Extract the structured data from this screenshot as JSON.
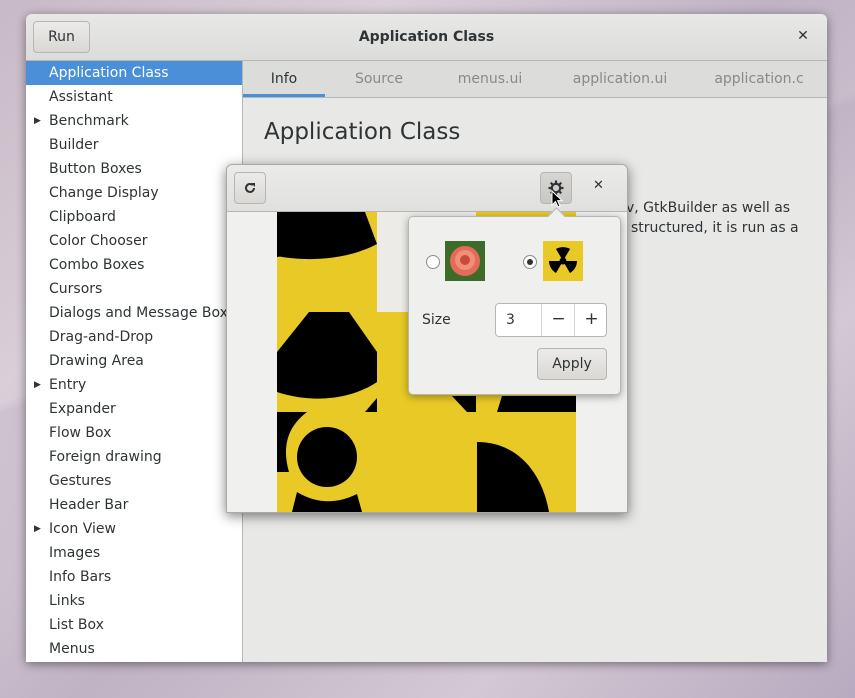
{
  "main_window": {
    "title": "Application Class",
    "run_label": "Run",
    "close_glyph": "✕"
  },
  "sidebar": {
    "items": [
      {
        "label": "Application Class",
        "selected": true,
        "expandable": false
      },
      {
        "label": "Assistant",
        "expandable": false
      },
      {
        "label": "Benchmark",
        "expandable": true
      },
      {
        "label": "Builder",
        "expandable": false
      },
      {
        "label": "Button Boxes",
        "expandable": false
      },
      {
        "label": "Change Display",
        "expandable": false
      },
      {
        "label": "Clipboard",
        "expandable": false
      },
      {
        "label": "Color Chooser",
        "expandable": false
      },
      {
        "label": "Combo Boxes",
        "expandable": false
      },
      {
        "label": "Cursors",
        "expandable": false
      },
      {
        "label": "Dialogs and Message Boxes",
        "expandable": false
      },
      {
        "label": "Drag-and-Drop",
        "expandable": false
      },
      {
        "label": "Drawing Area",
        "expandable": false
      },
      {
        "label": "Entry",
        "expandable": true
      },
      {
        "label": "Expander",
        "expandable": false
      },
      {
        "label": "Flow Box",
        "expandable": false
      },
      {
        "label": "Foreign drawing",
        "expandable": false
      },
      {
        "label": "Gestures",
        "expandable": false
      },
      {
        "label": "Header Bar",
        "expandable": false
      },
      {
        "label": "Icon View",
        "expandable": true
      },
      {
        "label": "Images",
        "expandable": false
      },
      {
        "label": "Info Bars",
        "expandable": false
      },
      {
        "label": "Links",
        "expandable": false
      },
      {
        "label": "List Box",
        "expandable": false
      },
      {
        "label": "Menus",
        "expandable": false
      }
    ]
  },
  "tabs": [
    {
      "label": "Info",
      "active": true
    },
    {
      "label": "Source"
    },
    {
      "label": "menus.ui"
    },
    {
      "label": "application.ui"
    },
    {
      "label": "application.c"
    }
  ],
  "info": {
    "heading": "Application Class",
    "line1_fragment": "v, GtkBuilder as well as",
    "line2_fragment": "structured, it is run as a"
  },
  "demo_window": {
    "close_glyph": "✕",
    "refresh_icon": "refresh-icon",
    "gear_icon": "gear-icon"
  },
  "popover": {
    "size_label": "Size",
    "size_value": "3",
    "minus": "−",
    "plus": "+",
    "apply_label": "Apply",
    "selected_image": "radiation"
  },
  "colors": {
    "selection": "#4a90d9",
    "canvas_yellow": "#e8c925"
  }
}
